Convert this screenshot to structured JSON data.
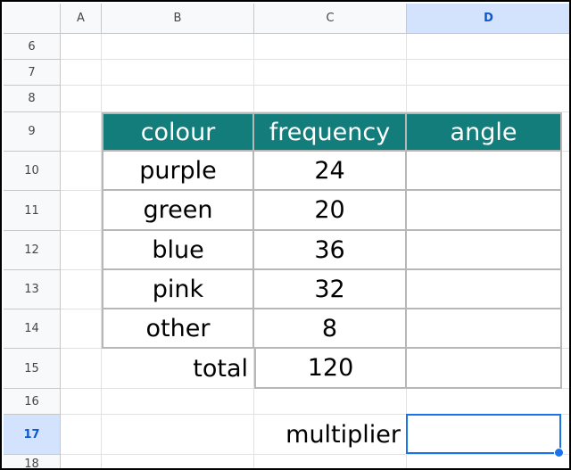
{
  "columns": [
    "A",
    "B",
    "C",
    "D"
  ],
  "rows": [
    "6",
    "7",
    "8",
    "9",
    "10",
    "11",
    "12",
    "13",
    "14",
    "15",
    "16",
    "17",
    "18"
  ],
  "table": {
    "headers": [
      "colour",
      "frequency",
      "angle"
    ],
    "data": [
      [
        "purple",
        "24",
        ""
      ],
      [
        "green",
        "20",
        ""
      ],
      [
        "blue",
        "36",
        ""
      ],
      [
        "pink",
        "32",
        ""
      ],
      [
        "other",
        "8",
        ""
      ]
    ],
    "total_label": "total",
    "total_value": "120"
  },
  "multiplier_label": "multiplier",
  "active_cell": "D17",
  "colors": {
    "header_fill": "#127d7b",
    "header_text": "#ffffff",
    "selection": "#1a73e8"
  }
}
